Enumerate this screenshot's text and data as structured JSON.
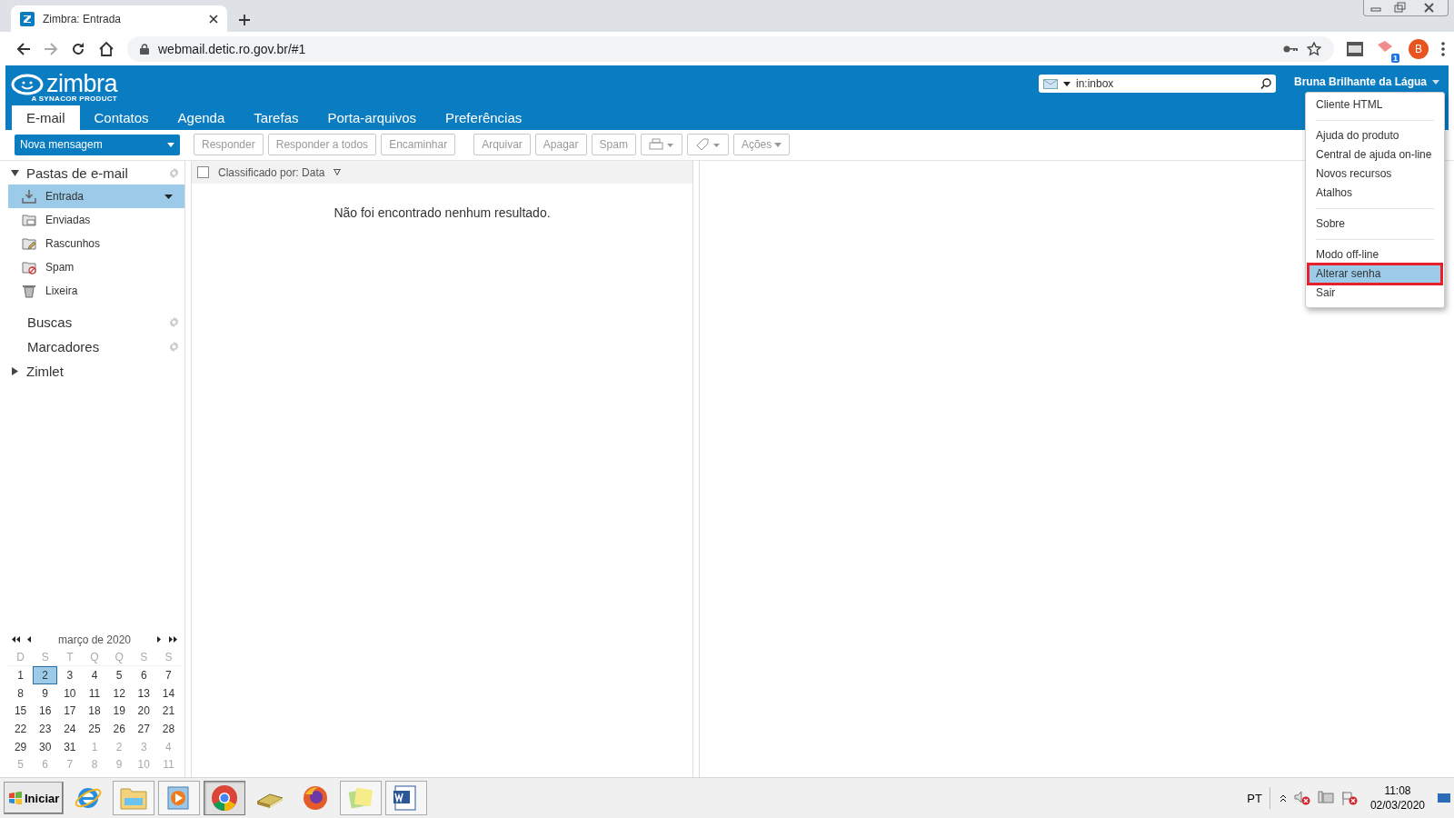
{
  "browser": {
    "tab_title": "Zimbra: Entrada",
    "address": "webmail.detic.ro.gov.br/#1",
    "profile_initial": "B",
    "extension_badge": "1"
  },
  "header": {
    "logo_text": "zimbra",
    "logo_tagline": "A SYNACOR PRODUCT",
    "search_value": "in:inbox",
    "user_name": "Bruna Brilhante da Lágua"
  },
  "tabs": [
    {
      "label": "E-mail",
      "selected": true
    },
    {
      "label": "Contatos",
      "selected": false
    },
    {
      "label": "Agenda",
      "selected": false
    },
    {
      "label": "Tarefas",
      "selected": false
    },
    {
      "label": "Porta-arquivos",
      "selected": false
    },
    {
      "label": "Preferências",
      "selected": false
    }
  ],
  "toolbar": {
    "new_message": "Nova mensagem",
    "buttons": [
      {
        "kind": "text",
        "label": "Responder",
        "disabled": true
      },
      {
        "kind": "text",
        "label": "Responder a todos",
        "disabled": true
      },
      {
        "kind": "text",
        "label": "Encaminhar",
        "disabled": true
      },
      {
        "kind": "gap"
      },
      {
        "kind": "text",
        "label": "Arquivar",
        "disabled": true
      },
      {
        "kind": "text",
        "label": "Apagar",
        "disabled": true
      },
      {
        "kind": "text",
        "label": "Spam",
        "disabled": true
      },
      {
        "kind": "print",
        "disabled": true
      },
      {
        "kind": "tag",
        "disabled": true
      },
      {
        "kind": "menu",
        "label": "Ações",
        "disabled": true
      }
    ]
  },
  "sidebar": {
    "folders_header": {
      "label": "Pastas de e-mail",
      "expanded": true
    },
    "folders": [
      {
        "kind": "inbox",
        "label": "Entrada",
        "selected": true
      },
      {
        "kind": "sent",
        "label": "Enviadas",
        "selected": false
      },
      {
        "kind": "drafts",
        "label": "Rascunhos",
        "selected": false
      },
      {
        "kind": "spam",
        "label": "Spam",
        "selected": false
      },
      {
        "kind": "trash",
        "label": "Lixeira",
        "selected": false
      }
    ],
    "sections": [
      {
        "label": "Buscas"
      },
      {
        "label": "Marcadores"
      }
    ],
    "zimlet": {
      "label": "Zimlet",
      "expanded": false
    }
  },
  "calendar": {
    "month": "março de 2020",
    "weekdays": [
      "D",
      "S",
      "T",
      "Q",
      "Q",
      "S",
      "S"
    ],
    "weeks": [
      [
        {
          "day": "1",
          "other_month": false,
          "selected": false
        },
        {
          "day": "2",
          "other_month": false,
          "selected": true
        },
        {
          "day": "3",
          "other_month": false,
          "selected": false
        },
        {
          "day": "4",
          "other_month": false,
          "selected": false
        },
        {
          "day": "5",
          "other_month": false,
          "selected": false
        },
        {
          "day": "6",
          "other_month": false,
          "selected": false
        },
        {
          "day": "7",
          "other_month": false,
          "selected": false
        }
      ],
      [
        {
          "day": "8",
          "other_month": false,
          "selected": false
        },
        {
          "day": "9",
          "other_month": false,
          "selected": false
        },
        {
          "day": "10",
          "other_month": false,
          "selected": false
        },
        {
          "day": "11",
          "other_month": false,
          "selected": false
        },
        {
          "day": "12",
          "other_month": false,
          "selected": false
        },
        {
          "day": "13",
          "other_month": false,
          "selected": false
        },
        {
          "day": "14",
          "other_month": false,
          "selected": false
        }
      ],
      [
        {
          "day": "15",
          "other_month": false,
          "selected": false
        },
        {
          "day": "16",
          "other_month": false,
          "selected": false
        },
        {
          "day": "17",
          "other_month": false,
          "selected": false
        },
        {
          "day": "18",
          "other_month": false,
          "selected": false
        },
        {
          "day": "19",
          "other_month": false,
          "selected": false
        },
        {
          "day": "20",
          "other_month": false,
          "selected": false
        },
        {
          "day": "21",
          "other_month": false,
          "selected": false
        }
      ],
      [
        {
          "day": "22",
          "other_month": false,
          "selected": false
        },
        {
          "day": "23",
          "other_month": false,
          "selected": false
        },
        {
          "day": "24",
          "other_month": false,
          "selected": false
        },
        {
          "day": "25",
          "other_month": false,
          "selected": false
        },
        {
          "day": "26",
          "other_month": false,
          "selected": false
        },
        {
          "day": "27",
          "other_month": false,
          "selected": false
        },
        {
          "day": "28",
          "other_month": false,
          "selected": false
        }
      ],
      [
        {
          "day": "29",
          "other_month": false,
          "selected": false
        },
        {
          "day": "30",
          "other_month": false,
          "selected": false
        },
        {
          "day": "31",
          "other_month": false,
          "selected": false
        },
        {
          "day": "1",
          "other_month": true,
          "selected": false
        },
        {
          "day": "2",
          "other_month": true,
          "selected": false
        },
        {
          "day": "3",
          "other_month": true,
          "selected": false
        },
        {
          "day": "4",
          "other_month": true,
          "selected": false
        }
      ],
      [
        {
          "day": "5",
          "other_month": true,
          "selected": false
        },
        {
          "day": "6",
          "other_month": true,
          "selected": false
        },
        {
          "day": "7",
          "other_month": true,
          "selected": false
        },
        {
          "day": "8",
          "other_month": true,
          "selected": false
        },
        {
          "day": "9",
          "other_month": true,
          "selected": false
        },
        {
          "day": "10",
          "other_month": true,
          "selected": false
        },
        {
          "day": "11",
          "other_month": true,
          "selected": false
        }
      ]
    ]
  },
  "list": {
    "select_all_checked": false,
    "sort_label": "Classificado por: Data",
    "empty_message": "Não foi encontrado nenhum resultado."
  },
  "menu": {
    "groups": [
      [
        {
          "label": "Cliente HTML",
          "selected": false,
          "outlined": false
        }
      ],
      [
        {
          "label": "Ajuda do produto",
          "selected": false,
          "outlined": false
        },
        {
          "label": "Central de ajuda on-line",
          "selected": false,
          "outlined": false
        },
        {
          "label": "Novos recursos",
          "selected": false,
          "outlined": false
        },
        {
          "label": "Atalhos",
          "selected": false,
          "outlined": false
        }
      ],
      [
        {
          "label": "Sobre",
          "selected": false,
          "outlined": false
        }
      ],
      [
        {
          "label": "Modo off-line",
          "selected": false,
          "outlined": false
        },
        {
          "label": "Alterar senha",
          "selected": true,
          "outlined": true
        },
        {
          "label": "Sair",
          "selected": false,
          "outlined": false
        }
      ]
    ]
  },
  "taskbar": {
    "start_label": "Iniciar",
    "apps": [
      {
        "kind": "ie",
        "open": false,
        "active": false
      },
      {
        "kind": "explorer",
        "open": true,
        "active": false
      },
      {
        "kind": "media",
        "open": true,
        "active": false
      },
      {
        "kind": "chrome",
        "open": true,
        "active": true
      },
      {
        "kind": "books",
        "open": false,
        "active": false
      },
      {
        "kind": "firefox",
        "open": false,
        "active": false
      },
      {
        "kind": "notes",
        "open": true,
        "active": false
      },
      {
        "kind": "word",
        "open": true,
        "active": false
      }
    ],
    "language": "PT",
    "time": "11:08",
    "date": "02/03/2020"
  }
}
